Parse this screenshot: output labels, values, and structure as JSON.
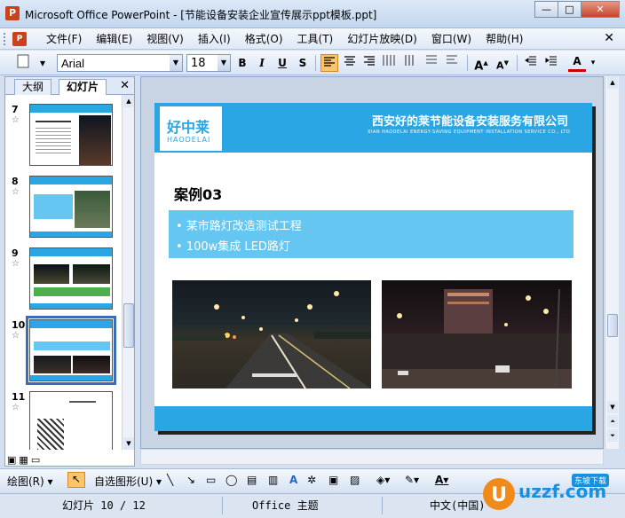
{
  "window": {
    "title": "Microsoft Office PowerPoint - [节能设备安装企业宣传展示ppt模板.ppt]",
    "min": "—",
    "max": "□",
    "close": "✕"
  },
  "menu": {
    "items": [
      "文件(F)",
      "编辑(E)",
      "视图(V)",
      "插入(I)",
      "格式(O)",
      "工具(T)",
      "幻灯片放映(D)",
      "窗口(W)",
      "帮助(H)"
    ],
    "close": "✕"
  },
  "toolbar": {
    "font_name": "Arial",
    "font_size": "18",
    "bold": "B",
    "italic": "I",
    "underline": "U",
    "shadow": "S",
    "font_color": "A"
  },
  "panel": {
    "tab_outline": "大纲",
    "tab_slides": "幻灯片",
    "close": "✕",
    "slides": [
      {
        "num": "7"
      },
      {
        "num": "8"
      },
      {
        "num": "9"
      },
      {
        "num": "10"
      },
      {
        "num": "11"
      }
    ]
  },
  "slide": {
    "logo_cn": "好中莱",
    "logo_en": "HAODELAI",
    "company_cn": "西安好的莱节能设备安装服务有限公司",
    "company_en": "XIAN HAODELAI ENERGY-SAVING EQUIPMENT INSTALLATION SERVICE CO., LTD",
    "case_title": "案例03",
    "bullets": [
      "• 某市路灯改造测试工程",
      "• 100w集成 LED路灯"
    ]
  },
  "drawbar": {
    "draw": "绘图(R) ▾",
    "autoshapes": "自选图形(U) ▾"
  },
  "status": {
    "slide_info": "幻灯片 10 / 12",
    "theme": "Office 主题",
    "language": "中文(中国)"
  },
  "watermark": {
    "brand": "uzzf.com",
    "tag": "东坡下载"
  },
  "colors": {
    "accent": "#2aa6e4",
    "bullet_box": "#64c6f1"
  }
}
